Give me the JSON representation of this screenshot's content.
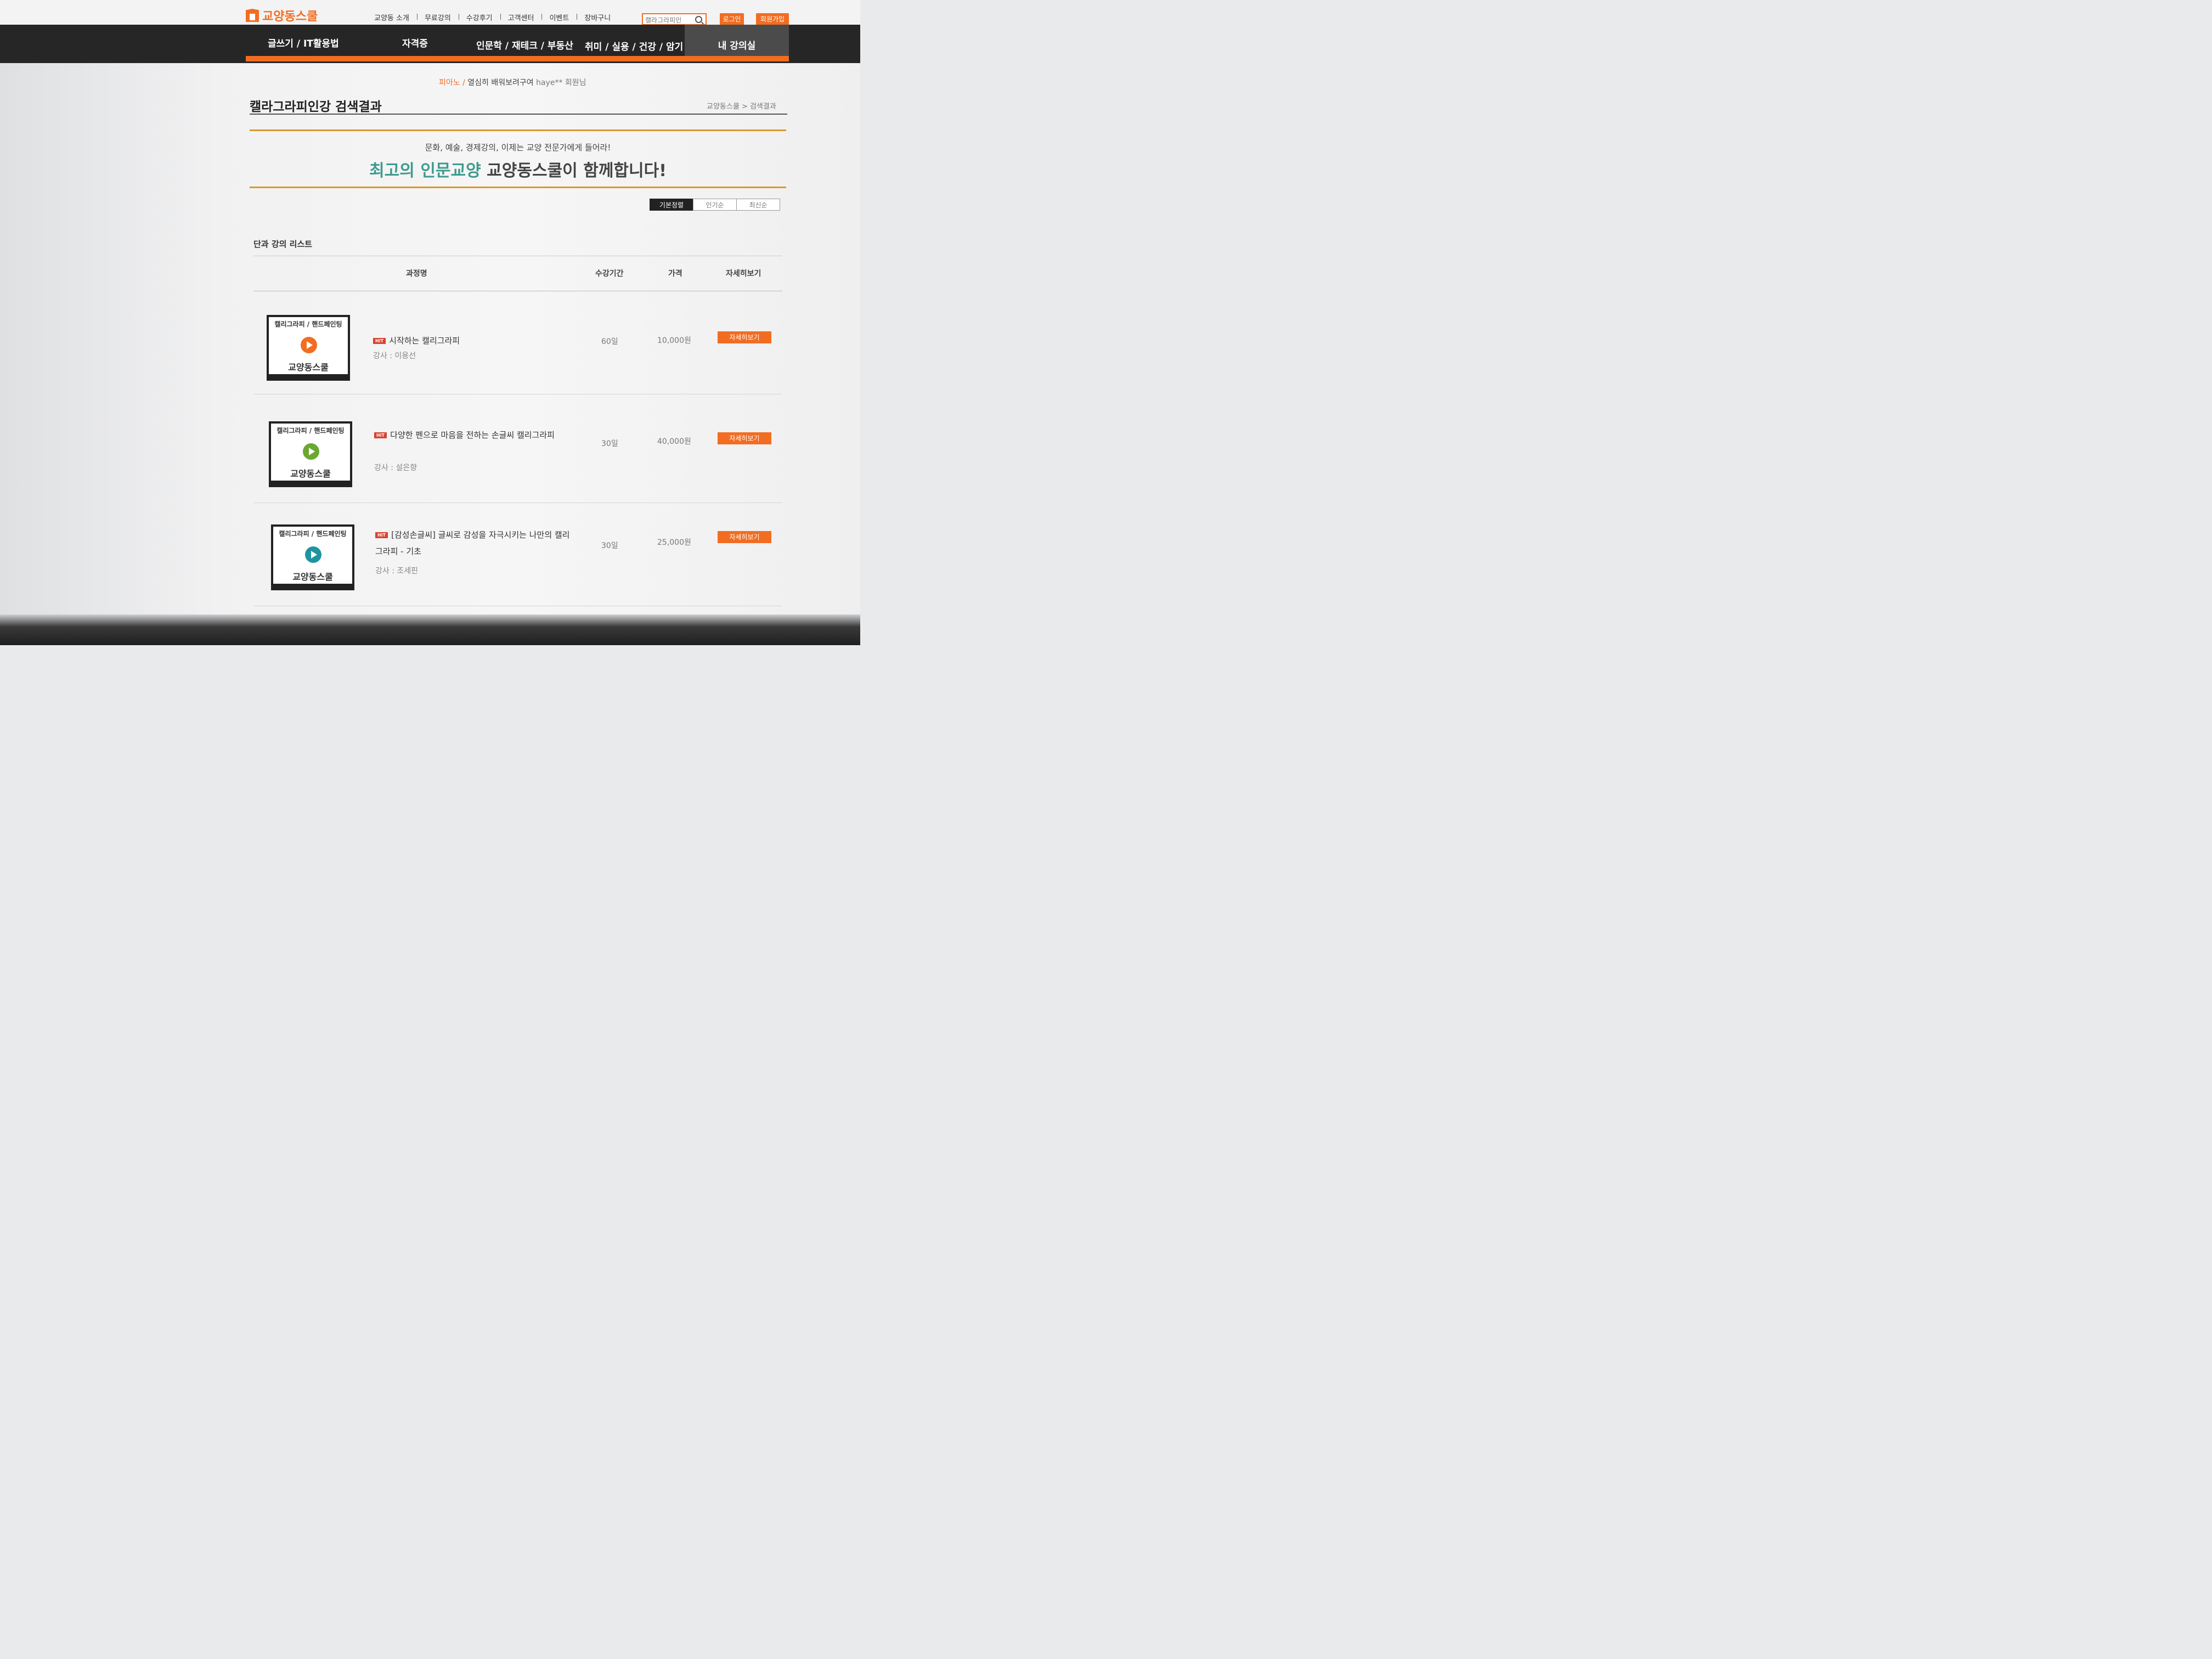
{
  "header": {
    "logo": "교양동스쿨",
    "nav": [
      "교양동 소개",
      "무료강의",
      "수강후기",
      "고객센터",
      "이벤트",
      "장바구니"
    ],
    "search_value": "캘라그라피인",
    "login": "로그인",
    "join": "회원가입"
  },
  "gnb": {
    "menus": [
      "글쓰기 / IT활용법",
      "자격증",
      "인문학 / 재테크 / 부동산",
      "취미 / 실용 / 건강 / 암기"
    ],
    "my_room": "내 강의실"
  },
  "ticker": {
    "category": "피아노 /",
    "text": " 열심히 배워보려구여 ",
    "user": "haye** 회원님"
  },
  "page": {
    "title": "캘라그라피인강 검색결과",
    "breadcrumb": "교양동스쿨 > 검색결과"
  },
  "banner": {
    "sub": "문화, 예술, 경제강의, 이제는 교양 전문가에게 들어라!",
    "main_teal": "최고의 인문교양",
    "main_dark": " 교양동스쿨이 함께합니다!"
  },
  "sort": [
    "기본정렬",
    "인기순",
    "최신순"
  ],
  "list": {
    "title": "단과 강의 리스트",
    "headers": {
      "name": "과정명",
      "period": "수강기간",
      "price": "가격",
      "detail": "자세히보기"
    },
    "courses": [
      {
        "thumb_category": "캘리그라피 / 핸드페인팅",
        "thumb_brand": "교양동스쿨",
        "badge": "HIT",
        "title": "시작하는 캘리그라피",
        "teacher": "강사 : 이용선",
        "period": "60일",
        "price": "10,000원",
        "detail": "자세히보기",
        "play_color": "#f26d21"
      },
      {
        "thumb_category": "캘리그라피 / 핸드페인팅",
        "thumb_brand": "교양동스쿨",
        "badge": "HIT",
        "title": "다양한 펜으로 마음을 전하는 손글씨 캘리그라피",
        "teacher": "강사 : 설은향",
        "period": "30일",
        "price": "40,000원",
        "detail": "자세히보기",
        "play_color": "#6aa832"
      },
      {
        "thumb_category": "캘리그라피 / 핸드페인팅",
        "thumb_brand": "교양동스쿨",
        "badge": "HIT",
        "title": "[감성손글씨] 글씨로 감성을 자극시키는 나만의 캘리그라피 - 기초",
        "teacher": "강사 : 조세핀",
        "period": "30일",
        "price": "25,000원",
        "detail": "자세히보기",
        "play_color": "#1f93a0"
      }
    ]
  }
}
